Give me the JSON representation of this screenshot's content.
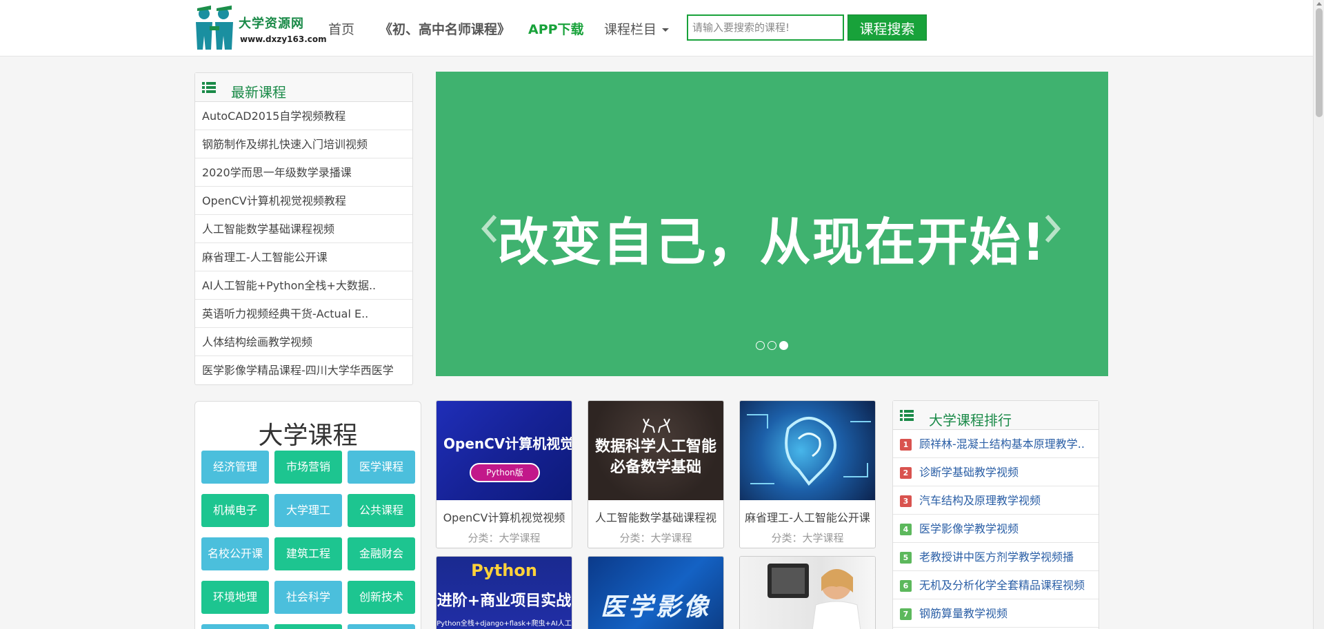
{
  "header": {
    "logo_title": "大学资源网",
    "logo_url": "www.dxzy163.com",
    "nav": {
      "home": "首页",
      "famous": "《初、高中名师课程》",
      "app": "APP下载",
      "columns": "课程栏目"
    },
    "search": {
      "placeholder": "请输入要搜索的课程!",
      "button": "课程搜索"
    }
  },
  "latest": {
    "title": "最新课程",
    "items": [
      "AutoCAD2015自学视频教程",
      "钢筋制作及绑扎快速入门培训视频",
      "2020学而思一年级数学录播课",
      "OpenCV计算机视觉视频教程",
      "人工智能数学基础课程视频",
      "麻省理工-人工智能公开课",
      "AI人工智能+Python全栈+大数据..",
      "英语听力视频经典干货-Actual E..",
      "人体结构绘画教学视频",
      "医学影像学精品课程-四川大学华西医学"
    ]
  },
  "banner": {
    "text": "改变自己，从现在开始!",
    "active_slide": 3,
    "slide_count": 3
  },
  "university": {
    "title": "大学课程",
    "tags": [
      "经济管理",
      "市场营销",
      "医学课程",
      "机械电子",
      "大学理工",
      "公共课程",
      "名校公开课",
      "建筑工程",
      "金融财会",
      "环境地理",
      "社会科学",
      "创新技术"
    ]
  },
  "cards": [
    {
      "name": "OpenCV计算机视觉视频",
      "category": "分类：大学课程",
      "thumb_title": "OpenCV计算机视觉实战",
      "thumb_badge": "Python版"
    },
    {
      "name": "人工智能数学基础课程视",
      "category": "分类：大学课程",
      "thumb_title_1": "数据科学人工智能",
      "thumb_title_2": "必备数学基础"
    },
    {
      "name": "麻省理工-人工智能公开课",
      "category": "分类：大学课程"
    },
    {
      "thumb_title": "Python",
      "thumb_subtitle": "进阶+商业项目实战",
      "thumb_note": "Python全栈+django+flask+爬虫+AI人工智能"
    },
    {
      "thumb_title": "医学影像学"
    },
    {}
  ],
  "ranking": {
    "title": "大学课程排行",
    "items": [
      {
        "num": "1",
        "label": "顾祥林-混凝土结构基本原理教学.."
      },
      {
        "num": "2",
        "label": "诊断学基础教学视频"
      },
      {
        "num": "3",
        "label": "汽车结构及原理教学视频"
      },
      {
        "num": "4",
        "label": "医学影像学教学视频"
      },
      {
        "num": "5",
        "label": "老教授讲中医方剂学教学视频播"
      },
      {
        "num": "6",
        "label": "无机及分析化学全套精品课程视频"
      },
      {
        "num": "7",
        "label": "钢筋算量教学视频"
      }
    ]
  },
  "colors": {
    "brand_green": "#18a23a",
    "banner_green": "#3fb26f",
    "tag_blue": "#4bbfdc",
    "tag_green": "#1dc590",
    "rank_red": "#d9534f",
    "rank_green": "#5cb85c"
  },
  "icons": {
    "logo": "graduate-figures-logo",
    "panel": "list-icon",
    "prev": "chevron-left-icon",
    "next": "chevron-right-icon",
    "caret": "caret-down-icon"
  }
}
